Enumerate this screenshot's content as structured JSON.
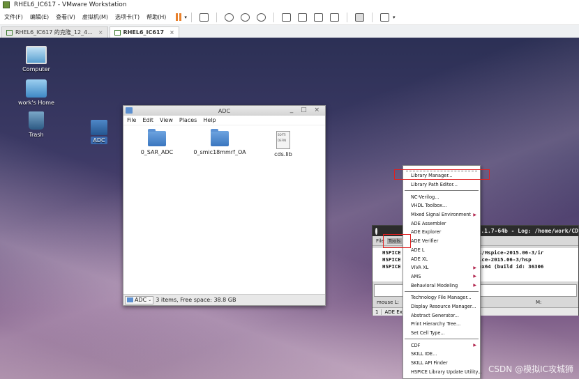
{
  "vmware": {
    "title": "RHEL6_IC617 - VMware Workstation",
    "menu": [
      "文件(F)",
      "编辑(E)",
      "查看(V)",
      "虚拟机(M)",
      "选项卡(T)",
      "帮助(H)"
    ],
    "tabs": [
      {
        "label": "RHEL6_IC617 的克隆_12_4...",
        "active": false
      },
      {
        "label": "RHEL6_IC617",
        "active": true
      }
    ]
  },
  "desktop": {
    "icons": [
      "Computer",
      "work's Home",
      "Trash",
      "ADC"
    ]
  },
  "file_manager": {
    "title": "ADC",
    "menu": [
      "File",
      "Edit",
      "View",
      "Places",
      "Help"
    ],
    "items": [
      {
        "name": "0_SAR_ADC",
        "type": "folder"
      },
      {
        "name": "0_smic18mmrf_OA",
        "type": "folder"
      },
      {
        "name": "cds.lib",
        "type": "file",
        "thumb": [
          "SOFTI",
          "DEFIN"
        ]
      }
    ],
    "status_location": "ADC",
    "status_text": "3 items, Free space: 38.8 GB"
  },
  "ciw": {
    "title": "6.1.7-64b - Log: /home/work/CD",
    "menu": [
      "File",
      "Tools"
    ],
    "log_lines": [
      "HSPICE :            opt/synopsys/Hspice-2015.06-3/ir",
      "HSPICE :           synopsys/Hspice-2015.06-3/hsp",
      "HSPICE :           015.06-3 linux64 (build id: 36306"
    ],
    "mouse_left": "mouse L:",
    "mouse_mid": "M:",
    "status_num": "1",
    "status_text": "ADE Expl"
  },
  "tools_menu": {
    "groups": [
      [
        {
          "label": "Library Manager...",
          "submenu": false
        },
        {
          "label": "Library Path Editor...",
          "submenu": false
        }
      ],
      [
        {
          "label": "NC-Verilog...",
          "submenu": false
        },
        {
          "label": "VHDL Toolbox...",
          "submenu": false
        },
        {
          "label": "Mixed Signal Environment",
          "submenu": true
        },
        {
          "label": "ADE Assembler",
          "submenu": false
        },
        {
          "label": "ADE Explorer",
          "submenu": false
        },
        {
          "label": "ADE Verifier",
          "submenu": false
        },
        {
          "label": "ADE L",
          "submenu": false
        },
        {
          "label": "ADE XL",
          "submenu": false
        },
        {
          "label": "VIVA XL",
          "submenu": true
        },
        {
          "label": "AMS",
          "submenu": true
        },
        {
          "label": "Behavioral Modeling",
          "submenu": true
        }
      ],
      [
        {
          "label": "Technology File Manager...",
          "submenu": false
        },
        {
          "label": "Display Resource Manager...",
          "submenu": false
        },
        {
          "label": "Abstract Generator...",
          "submenu": false
        },
        {
          "label": "Print Hierarchy Tree...",
          "submenu": false
        },
        {
          "label": "Set Cell Type...",
          "submenu": false
        }
      ],
      [
        {
          "label": "CDF",
          "submenu": true
        },
        {
          "label": "SKILL IDE...",
          "submenu": false
        },
        {
          "label": "SKILL API Finder",
          "submenu": false
        },
        {
          "label": "HSPICE Library Update Utility...",
          "submenu": false
        }
      ]
    ]
  },
  "watermark": "CSDN @模拟IC攻城狮",
  "colors": {
    "highlight": "#e02020",
    "pause": "#e8802b",
    "folder": "#3a76bf"
  }
}
